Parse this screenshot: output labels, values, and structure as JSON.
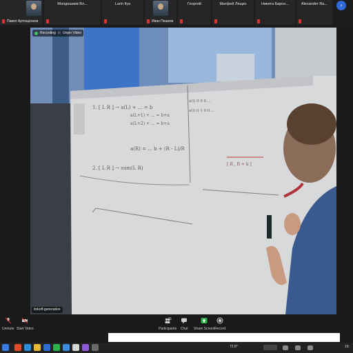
{
  "participants": [
    {
      "name": "",
      "video_name": "Павел Артющенков",
      "has_video": true
    },
    {
      "name": "Молдошиев Вл...",
      "video_name": "",
      "has_video": false
    },
    {
      "name": "Larin Ilya",
      "video_name": "",
      "has_video": false
    },
    {
      "name": "",
      "video_name": "Иван Пешков",
      "has_video": true
    },
    {
      "name": "Георгий",
      "video_name": "",
      "has_video": false
    },
    {
      "name": "Матфей Лящко",
      "video_name": "",
      "has_video": false
    },
    {
      "name": "Никита Барон...",
      "video_name": "",
      "has_video": false
    },
    {
      "name": "Alexander Ra...",
      "video_name": "",
      "has_video": false
    }
  ],
  "nav": {
    "next_icon": "chevron-right-icon"
  },
  "recording": {
    "label": "Recording"
  },
  "unpin": {
    "label": "Unpin Video"
  },
  "speaker": {
    "name": "tinkoff-generation"
  },
  "toolbar": {
    "unmute": "Unmute",
    "start_video": "Start Video",
    "participants": "Participants",
    "participants_count": "11",
    "chat": "Chat",
    "share_screen": "Share Screen",
    "record": "Record"
  },
  "board": {
    "line1": "1. [ L  R ] → a(L) + ... = b",
    "line2": "a(L+1) + ... = b+a",
    "line3": "a(L+2) + ... = b+a",
    "line4": "a(R) = ... b + (R - L)/R",
    "line5": "2. [ L  R ] → sum(L  R)",
    "right1": "a(i)  0  0  0  ...",
    "right2": "a(i) 0  1  0  0  ...",
    "right3": "[ R  ,  R + k ]"
  },
  "taskbar": {
    "temperature": "72.8°",
    "clock": "16:"
  },
  "colors": {
    "accent": "#2e6ad8",
    "mic_off": "#d33333",
    "rec": "#3ec45a",
    "share": "#2bb24c"
  }
}
